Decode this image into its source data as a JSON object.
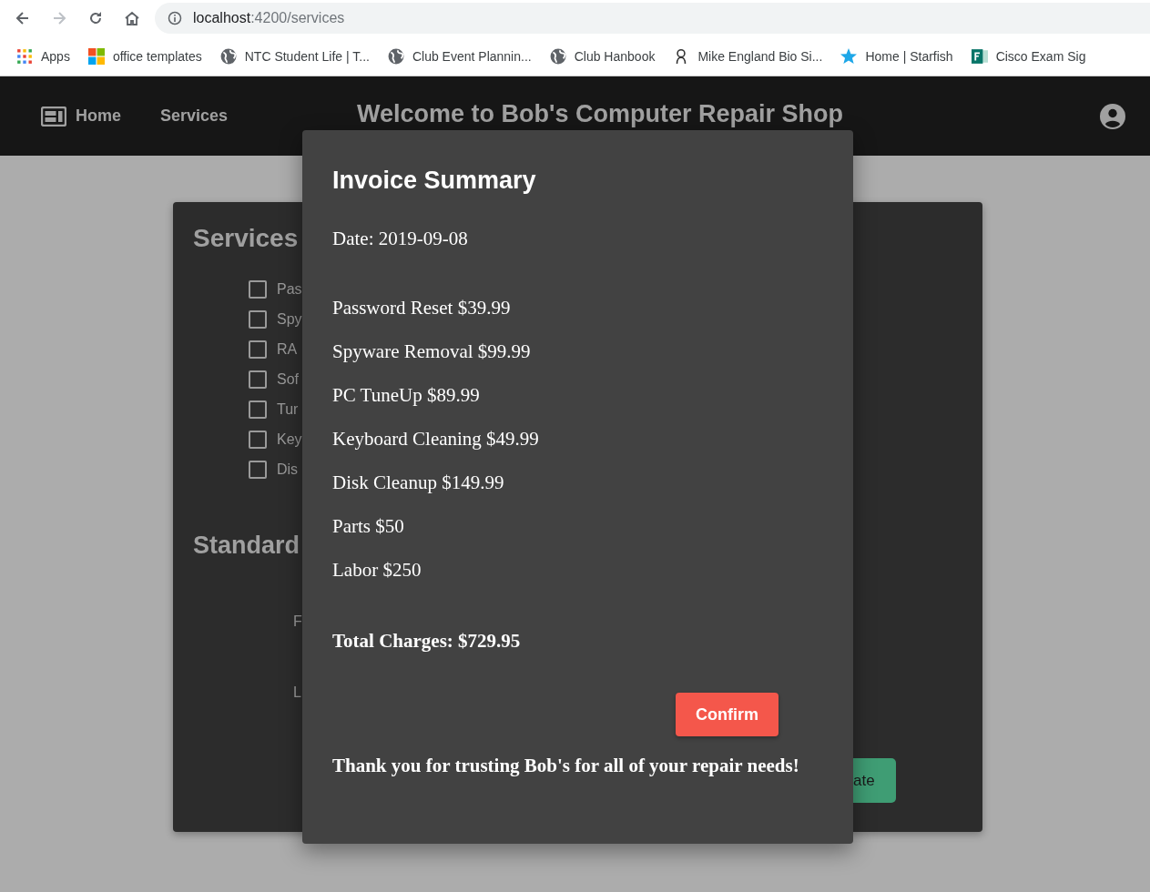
{
  "browser": {
    "address": {
      "host": "localhost",
      "path": ":4200/services"
    },
    "bookmarks": [
      {
        "label": "Apps",
        "kind": "apps"
      },
      {
        "label": "office templates",
        "kind": "windows"
      },
      {
        "label": "NTC Student Life | T...",
        "kind": "globe"
      },
      {
        "label": "Club Event Plannin...",
        "kind": "globe"
      },
      {
        "label": "Club Hanbook",
        "kind": "globe"
      },
      {
        "label": "Mike England Bio Si...",
        "kind": "figure"
      },
      {
        "label": "Home | Starfish",
        "kind": "star"
      },
      {
        "label": "Cisco Exam Sig",
        "kind": "forms"
      }
    ]
  },
  "nav": {
    "items": [
      {
        "label": "Home",
        "kind": "home"
      },
      {
        "label": "Services",
        "kind": "plain"
      }
    ],
    "title": "Welcome to Bob's Computer Repair Shop"
  },
  "card": {
    "heading": "Services",
    "items": [
      {
        "label": "Pas",
        "checked": false
      },
      {
        "label": "Spy",
        "checked": false
      },
      {
        "label": "RA",
        "checked": false
      },
      {
        "label": "Sof",
        "checked": false
      },
      {
        "label": "Tur",
        "checked": false
      },
      {
        "label": "Key",
        "checked": false
      },
      {
        "label": "Dis",
        "checked": false
      }
    ],
    "standard_heading": "Standard",
    "fields": [
      "F",
      "L"
    ],
    "button": "ate"
  },
  "dialog": {
    "title": "Invoice Summary",
    "date": "Date: 2019-09-08",
    "lines": [
      "Password Reset $39.99",
      "Spyware Removal $99.99",
      "PC TuneUp $89.99",
      "Keyboard Cleaning $49.99",
      "Disk Cleanup $149.99",
      "Parts $50",
      "Labor $250"
    ],
    "total": "Total Charges: $729.95",
    "button": "Confirm",
    "thanks": "Thank you for trusting Bob's for all of your repair needs!"
  }
}
